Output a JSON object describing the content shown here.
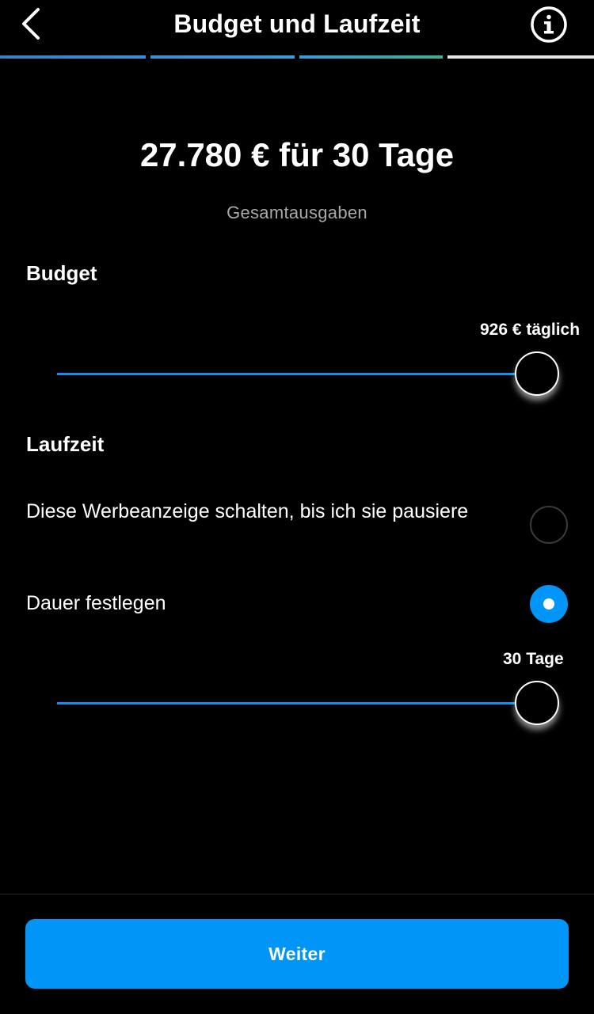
{
  "header": {
    "title": "Budget und Laufzeit",
    "back_icon": "chevron-left-icon",
    "info_icon": "info-icon"
  },
  "progress": {
    "steps": 4,
    "completed": 3,
    "colors": [
      "#3a8bd0",
      "#3a8bd0",
      "#3aa89a",
      "#e6e6e6"
    ]
  },
  "summary": {
    "total": "27.780 € für 30 Tage",
    "subtitle": "Gesamtausgaben"
  },
  "budget": {
    "title": "Budget",
    "value_label": "926 € täglich",
    "level": 1.0
  },
  "duration": {
    "title": "Laufzeit",
    "options": [
      {
        "label": "Diese Werbeanzeige schalten, bis ich sie pausiere",
        "selected": false
      },
      {
        "label": "Dauer festlegen",
        "selected": true
      }
    ],
    "value_label": "30 Tage",
    "level": 1.0
  },
  "footer": {
    "next_label": "Weiter"
  },
  "colors": {
    "accent": "#0095f6",
    "background": "#000000",
    "muted_text": "#a8a8a8"
  }
}
